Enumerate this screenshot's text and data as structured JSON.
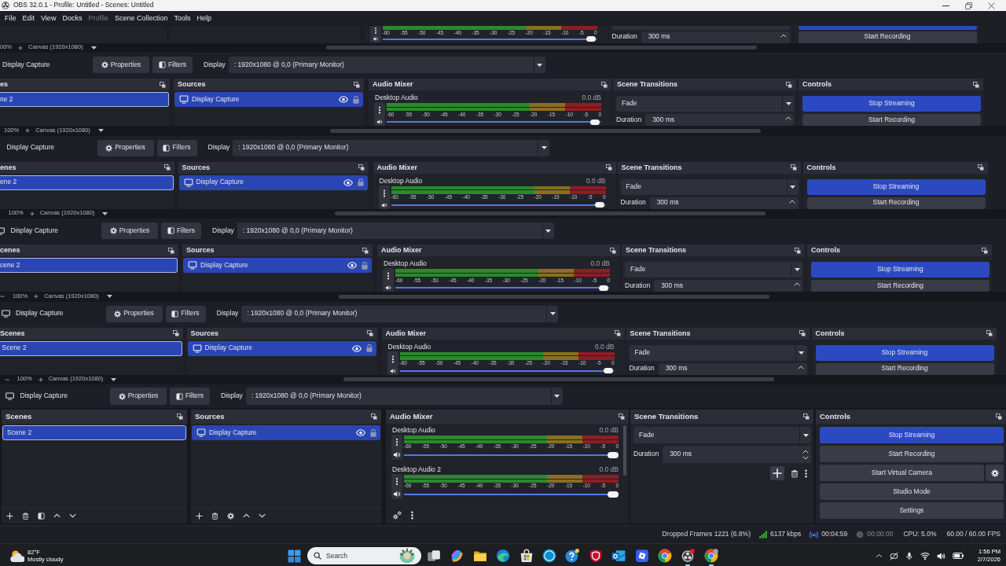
{
  "window": {
    "title": "OBS 32.0.1 - Profile: Untitled - Scenes: Untitled"
  },
  "menu": [
    {
      "label": "File",
      "disabled": false
    },
    {
      "label": "Edit",
      "disabled": false
    },
    {
      "label": "View",
      "disabled": false
    },
    {
      "label": "Docks",
      "disabled": false
    },
    {
      "label": "Profile",
      "disabled": true
    },
    {
      "label": "Scene Collection",
      "disabled": false
    },
    {
      "label": "Tools",
      "disabled": false
    },
    {
      "label": "Help",
      "disabled": false
    }
  ],
  "preview": {
    "top": {
      "channel": {
        "ticks": [
          "-60",
          "-55",
          "-50",
          "-45",
          "-40",
          "-35",
          "-30",
          "-25",
          "-20",
          "-15",
          "-10",
          "-5",
          "0"
        ],
        "level": 1
      },
      "duration_label": "Duration",
      "duration_value": "300 ms",
      "record_button": "Start Recording",
      "zoom": {
        "percent": "00%",
        "canvas": "Canvas (1920x1080)"
      }
    },
    "strips": [
      {
        "toolbar": {
          "source": "Display Capture",
          "properties": "Properties",
          "filters": "Filters",
          "display_label": "Display",
          "display_value": ": 1920x1080 @ 0,0 (Primary Monitor)"
        },
        "docks": {
          "scenes": {
            "title": "es",
            "items": [
              {
                "label": "ne 2",
                "selected": true
              }
            ]
          },
          "sources": {
            "title": "Sources",
            "items": [
              {
                "label": "Display Capture",
                "selected": true,
                "visible": true,
                "locked": false
              }
            ]
          },
          "audio_mixer": {
            "title": "Audio Mixer",
            "channels": [
              {
                "name": "Desktop Audio",
                "reading": "0.0 dB",
                "ticks": [
                  "-60",
                  "-55",
                  "-50",
                  "-45",
                  "-40",
                  "-35",
                  "-30",
                  "-25",
                  "-20",
                  "-15",
                  "-10",
                  "-5",
                  "0"
                ],
                "level": 1
              }
            ]
          },
          "scene_transitions": {
            "title": "Scene Transitions",
            "transition": "Fade",
            "duration_label": "Duration",
            "duration_value": "300 ms"
          },
          "controls": {
            "title": "Controls",
            "buttons": [
              {
                "label": "Stop Streaming",
                "kind": "plain",
                "checked": true
              },
              {
                "label": "Start Recording",
                "kind": "plain",
                "checked": false
              }
            ]
          }
        },
        "zoom": {
          "percent": "100%",
          "canvas": "Canvas (1920x1080)"
        }
      },
      {
        "toolbar": {
          "source": "Display Capture",
          "properties": "Properties",
          "filters": "Filters",
          "display_label": "Display",
          "display_value": ": 1920x1080 @ 0,0 (Primary Monitor)"
        },
        "docks": {
          "scenes": {
            "title": "enes",
            "items": [
              {
                "label": "ene 2",
                "selected": true
              }
            ]
          },
          "sources": {
            "title": "Sources",
            "items": [
              {
                "label": "Display Capture",
                "selected": true,
                "visible": true,
                "locked": false
              }
            ]
          },
          "audio_mixer": {
            "title": "Audio Mixer",
            "channels": [
              {
                "name": "Desktop Audio",
                "reading": "0.0 dB",
                "ticks": [
                  "-60",
                  "-55",
                  "-50",
                  "-45",
                  "-40",
                  "-35",
                  "-30",
                  "-25",
                  "-20",
                  "-15",
                  "-10",
                  "-5",
                  "0"
                ],
                "level": 1
              }
            ]
          },
          "scene_transitions": {
            "title": "Scene Transitions",
            "transition": "Fade",
            "duration_label": "Duration",
            "duration_value": "300 ms"
          },
          "controls": {
            "title": "Controls",
            "buttons": [
              {
                "label": "Stop Streaming",
                "kind": "plain",
                "checked": true
              },
              {
                "label": "Start Recording",
                "kind": "plain",
                "checked": false
              }
            ]
          }
        },
        "zoom": {
          "percent": "100%",
          "canvas": "Canvas (1920x1080)"
        }
      },
      {
        "toolbar": {
          "source": "Display Capture",
          "properties": "Properties",
          "filters": "Filters",
          "display_label": "Display",
          "display_value": ": 1920x1080 @ 0,0 (Primary Monitor)"
        },
        "docks": {
          "scenes": {
            "title": "cenes",
            "items": [
              {
                "label": "cene 2",
                "selected": true
              }
            ]
          },
          "sources": {
            "title": "Sources",
            "items": [
              {
                "label": "Display Capture",
                "selected": true,
                "visible": true,
                "locked": false
              }
            ]
          },
          "audio_mixer": {
            "title": "Audio Mixer",
            "channels": [
              {
                "name": "Desktop Audio",
                "reading": "0.0 dB",
                "ticks": [
                  "-60",
                  "-55",
                  "-50",
                  "-45",
                  "-40",
                  "-35",
                  "-30",
                  "-25",
                  "-20",
                  "-15",
                  "-10",
                  "-5",
                  "0"
                ],
                "level": 1
              }
            ]
          },
          "scene_transitions": {
            "title": "Scene Transitions",
            "transition": "Fade",
            "duration_label": "Duration",
            "duration_value": "300 ms"
          },
          "controls": {
            "title": "Controls",
            "buttons": [
              {
                "label": "Stop Streaming",
                "kind": "plain",
                "checked": true
              },
              {
                "label": "Start Recording",
                "kind": "plain",
                "checked": false
              }
            ]
          }
        },
        "zoom": {
          "percent": "100%",
          "canvas": "Canvas (1920x1080)"
        }
      },
      {
        "toolbar": {
          "source": "Display Capture",
          "properties": "Properties",
          "filters": "Filters",
          "display_label": "Display",
          "display_value": ": 1920x1080 @ 0,0 (Primary Monitor)"
        },
        "docks": {
          "scenes": {
            "title": "Scenes",
            "items": [
              {
                "label": "Scene 2",
                "selected": true
              }
            ]
          },
          "sources": {
            "title": "Sources",
            "items": [
              {
                "label": "Display Capture",
                "selected": true,
                "visible": true,
                "locked": false
              }
            ]
          },
          "audio_mixer": {
            "title": "Audio Mixer",
            "channels": [
              {
                "name": "Desktop Audio",
                "reading": "0.0 dB",
                "ticks": [
                  "-60",
                  "-55",
                  "-50",
                  "-45",
                  "-40",
                  "-35",
                  "-30",
                  "-25",
                  "-20",
                  "-15",
                  "-10",
                  "-5",
                  "0"
                ],
                "level": 1
              }
            ]
          },
          "scene_transitions": {
            "title": "Scene Transitions",
            "transition": "Fade",
            "duration_label": "Duration",
            "duration_value": "300 ms"
          },
          "controls": {
            "title": "Controls",
            "buttons": [
              {
                "label": "Stop Streaming",
                "kind": "plain",
                "checked": true
              },
              {
                "label": "Start Recording",
                "kind": "plain",
                "checked": false
              }
            ]
          }
        },
        "zoom": {
          "percent": "100%",
          "canvas": "Canvas (1920x1080)"
        }
      }
    ]
  },
  "source_toolbar": {
    "source": "Display Capture",
    "properties": "Properties",
    "filters": "Filters",
    "display_label": "Display",
    "display_value": ": 1920x1080 @ 0,0 (Primary Monitor)"
  },
  "docks": {
    "scenes": {
      "title": "Scenes",
      "items": [
        {
          "label": "Scene 2",
          "selected": true
        }
      ]
    },
    "sources": {
      "title": "Sources",
      "items": [
        {
          "label": "Display Capture",
          "selected": true,
          "visible": true,
          "locked": false
        }
      ]
    },
    "audio_mixer": {
      "title": "Audio Mixer",
      "channels": [
        {
          "name": "Desktop Audio",
          "reading": "0.0 dB",
          "ticks": [
            "-60",
            "-55",
            "-50",
            "-45",
            "-40",
            "-35",
            "-30",
            "-25",
            "-20",
            "-15",
            "-10",
            "-5",
            "0"
          ],
          "level": 1
        },
        {
          "name": "Desktop Audio 2",
          "reading": "0.0 dB",
          "ticks": [
            "-60",
            "-55",
            "-50",
            "-45",
            "-40",
            "-35",
            "-30",
            "-25",
            "-20",
            "-15",
            "-10",
            "-5",
            "0"
          ],
          "level": 1
        }
      ]
    },
    "scene_transitions": {
      "title": "Scene Transitions",
      "transition": "Fade",
      "duration_label": "Duration",
      "duration_value": "300 ms"
    },
    "controls": {
      "title": "Controls",
      "buttons": [
        {
          "label": "Stop Streaming",
          "kind": "plain",
          "checked": true
        },
        {
          "label": "Start Recording",
          "kind": "plain",
          "checked": false
        },
        {
          "label": "Start Virtual Camera",
          "kind": "with_settings",
          "checked": false
        },
        {
          "label": "Studio Mode",
          "kind": "plain",
          "checked": false
        },
        {
          "label": "Settings",
          "kind": "plain",
          "checked": false
        }
      ]
    }
  },
  "status_bar": {
    "dropped_frames": "Dropped Frames 1221 (6.8%)",
    "bitrate": "6137 kbps",
    "streaming": true,
    "stream_time": "00:04:59",
    "recording": false,
    "record_time": "00:00:00",
    "cpu": "CPU: 5.0%",
    "fps": "60.00 / 60.00 FPS"
  },
  "taskbar": {
    "weather": {
      "temperature": "82°F",
      "condition": "Mostly cloudy"
    },
    "search": {
      "placeholder": "Search"
    },
    "apps": [
      {
        "kind": "task_view",
        "running": false
      },
      {
        "kind": "swirl",
        "running": false
      },
      {
        "kind": "folder",
        "running": false
      },
      {
        "kind": "swirl_circle",
        "running": false
      },
      {
        "kind": "bag",
        "running": false
      },
      {
        "kind": "round_logo",
        "running": false
      },
      {
        "kind": "question",
        "running": false
      },
      {
        "kind": "shield",
        "running": false
      },
      {
        "kind": "mail",
        "running": false
      },
      {
        "kind": "tilted_square",
        "running": false
      },
      {
        "kind": "tricolor",
        "running": false
      },
      {
        "kind": "round_app",
        "running": true
      },
      {
        "kind": "tricolor_profile",
        "running": true
      }
    ],
    "time": "1:56 PM",
    "date": "2/7/2026"
  }
}
